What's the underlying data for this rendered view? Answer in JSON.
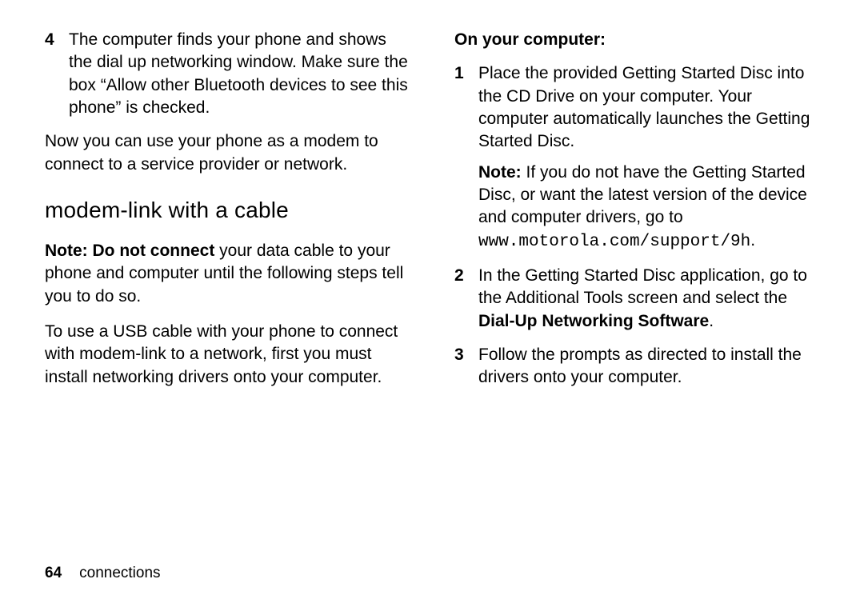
{
  "left": {
    "step4_num": "4",
    "step4_text": "The computer finds your phone and shows the dial up networking window. Make sure the box “Allow other Bluetooth devices to see this phone” is checked.",
    "para_after": "Now you can use your phone as a modem to connect to a service provider or network.",
    "heading": "modem-link with a cable",
    "note_prefix": "Note: Do not connect",
    "note_rest": " your data cable to your phone and computer until the following steps tell you to do so.",
    "para_usb": "To use a USB cable with your phone to connect with modem-link to a network, first you must install networking drivers onto your computer."
  },
  "right": {
    "subheading": "On your computer:",
    "s1_num": "1",
    "s1_text": "Place the provided Getting Started Disc into the CD Drive on your computer. Your computer automatically launches the Getting Started Disc.",
    "s1_note_prefix": "Note:",
    "s1_note_rest": " If you do not have the Getting Started Disc, or want the latest version of the device and computer drivers, go to ",
    "s1_url": "www.motorola.com/support/9h",
    "s1_period": ".",
    "s2_num": "2",
    "s2_text_a": "In the Getting Started Disc application, go to the Additional Tools screen and select the ",
    "s2_bold": "Dial-Up Networking Software",
    "s2_text_b": ".",
    "s3_num": "3",
    "s3_text": "Follow the prompts as directed to install the drivers onto your computer."
  },
  "footer": {
    "page_number": "64",
    "section": "connections"
  }
}
